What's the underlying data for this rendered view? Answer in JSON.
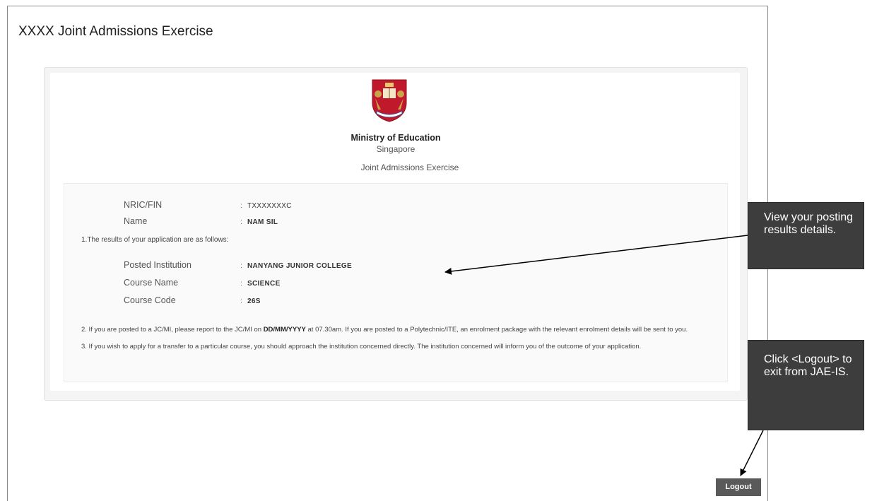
{
  "header": {
    "title": "XXXX Joint Admissions Exercise"
  },
  "org": {
    "name": "Ministry of Education",
    "country": "Singapore",
    "exercise": "Joint Admissions Exercise"
  },
  "identity": {
    "nric_label": "NRIC/FIN",
    "nric_value": "TXXXXXXXC",
    "name_label": "Name",
    "name_value": "NAM SIL"
  },
  "results": {
    "intro": "1.The results of your application are as follows:",
    "institution_label": "Posted Institution",
    "institution_value": "NANYANG JUNIOR COLLEGE",
    "course_name_label": "Course Name",
    "course_name_value": "SCIENCE",
    "course_code_label": "Course Code",
    "course_code_value": "26S"
  },
  "notes": {
    "note2_before": "2. If you are posted to a JC/MI, please report to the JC/MI on ",
    "note2_date": "DD/MM/YYYY",
    "note2_after": " at 07.30am. If you are posted to a Polytechnic/ITE, an enrolment package with the relevant enrolment details will be sent to you.",
    "note3": "3. If you wish to apply for a transfer to a particular course, you should approach the institution concerned directly. The institution concerned will inform you of the outcome of your application."
  },
  "callouts": {
    "results": "View your posting results details.",
    "logout": "Click <Logout> to exit from JAE-IS."
  },
  "actions": {
    "logout_label": "Logout"
  },
  "colors": {
    "callout_bg": "#3d3d3d",
    "crest_red": "#c0192c",
    "logout_bg": "#5a5a5a"
  }
}
